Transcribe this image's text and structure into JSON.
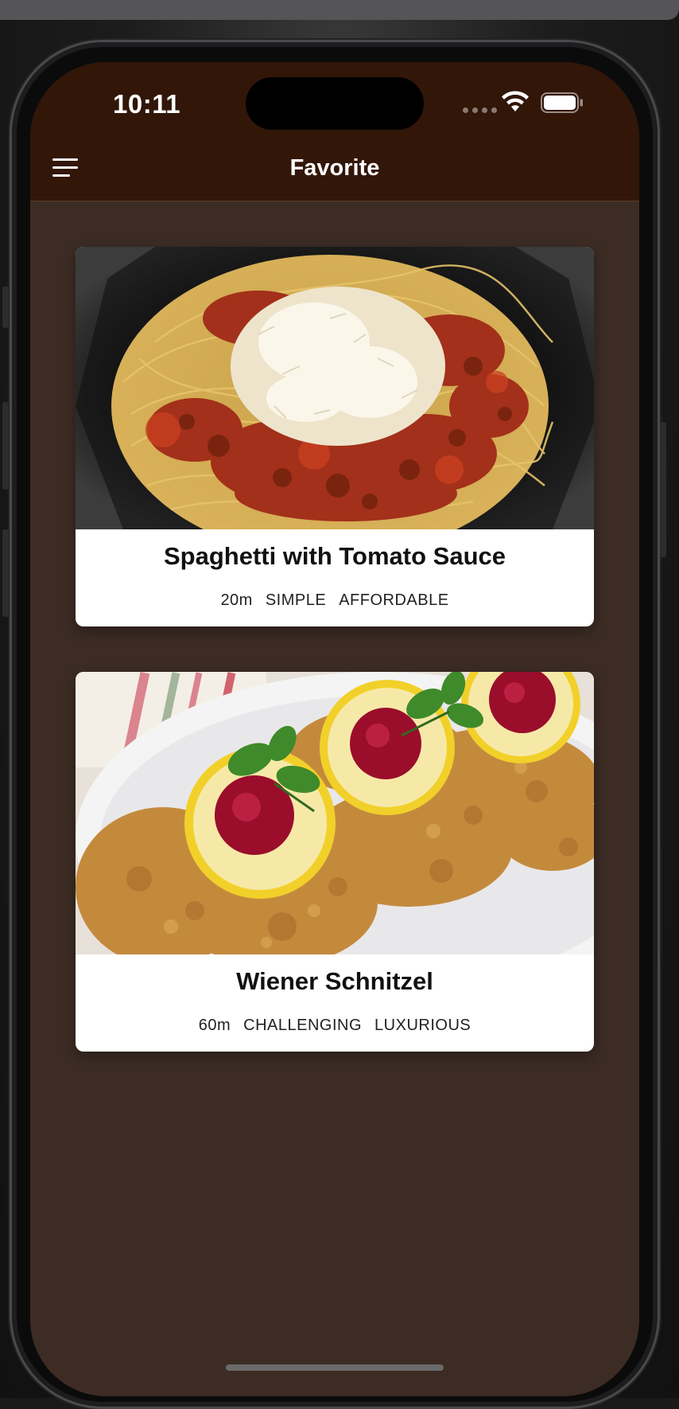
{
  "status_bar": {
    "time": "10:11"
  },
  "nav": {
    "title": "Favorite",
    "menu_icon": "hamburger-menu-icon"
  },
  "meals": [
    {
      "title": "Spaghetti with Tomato Sauce",
      "duration": "20m",
      "complexity": "SIMPLE",
      "affordability": "AFFORDABLE"
    },
    {
      "title": "Wiener Schnitzel",
      "duration": "60m",
      "complexity": "CHALLENGING",
      "affordability": "LUXURIOUS"
    }
  ],
  "colors": {
    "header": "#321608",
    "background": "#3c2c24",
    "card": "#ffffff"
  }
}
